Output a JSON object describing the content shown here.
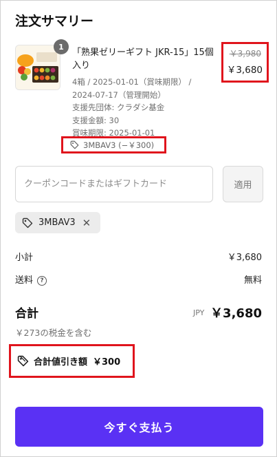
{
  "header": {
    "title": "注文サマリー"
  },
  "product": {
    "quantity": "1",
    "name": "「熟果ゼリーギフト JKR-15」15個入り",
    "meta": [
      "4箱 / 2025-01-01（賞味期限） /",
      "2024-07-17（管理開始）",
      "支援先団体: クラダシ基金",
      "支援金額: 30",
      "賞味期限: 2025-01-01"
    ],
    "price_original": "￥3,980",
    "price_current": "￥3,680",
    "discount_tag": "3MBAV3 (−￥300)"
  },
  "coupon": {
    "placeholder": "クーポンコードまたはギフトカード",
    "apply_label": "適用",
    "applied_code": "3MBAV3",
    "remove_glyph": "✕"
  },
  "summary": {
    "subtotal_label": "小計",
    "subtotal_value": "￥3,680",
    "shipping_label": "送料",
    "shipping_help": "?",
    "shipping_value": "無料",
    "total_label": "合計",
    "total_currency": "JPY",
    "total_value": "￥3,680",
    "tax_note": "￥273の税金を含む",
    "savings_label": "合計値引き額",
    "savings_value": "￥300"
  },
  "actions": {
    "pay_label": "今すぐ支払う"
  },
  "icons": {
    "tag": "tag-icon",
    "help": "help-circle-icon",
    "close": "close-icon"
  },
  "colors": {
    "accent": "#5a31f4",
    "highlight": "#e0141c"
  }
}
